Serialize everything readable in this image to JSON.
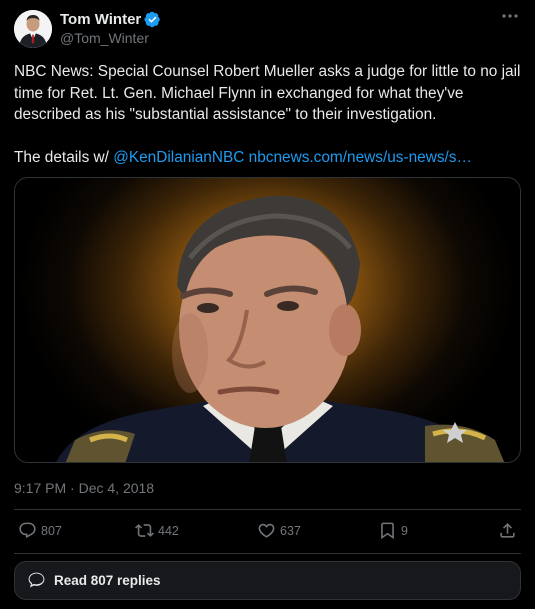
{
  "author": {
    "display_name": "Tom Winter",
    "handle": "@Tom_Winter",
    "verified": true,
    "verified_color": "#1d9bf0"
  },
  "more_icon": "ellipsis-icon",
  "tweet": {
    "text_main": "NBC News: Special Counsel Robert Mueller asks a judge for little to no jail time for Ret. Lt. Gen. Michael Flynn in exchanged for what they've described as his \"substantial assistance\" to their investigation.\n\nThe details w/ ",
    "mention": "@KenDilanianNBC",
    "link": "nbcnews.com/news/us-news/s…",
    "link_color": "#1d9bf0"
  },
  "media": {
    "icon": "photo-icon"
  },
  "timestamp": {
    "time": "9:17 PM",
    "separator": " · ",
    "date": "Dec 4, 2018"
  },
  "actions": {
    "reply": {
      "icon": "reply-icon",
      "count": "807"
    },
    "retweet": {
      "icon": "retweet-icon",
      "count": "442"
    },
    "like": {
      "icon": "heart-icon",
      "count": "637"
    },
    "bookmark": {
      "icon": "bookmark-icon",
      "count": "9"
    },
    "share": {
      "icon": "share-icon"
    }
  },
  "replies_button": {
    "icon": "speech-bubble-icon",
    "label": "Read 807 replies"
  },
  "colors": {
    "background": "#000000",
    "text": "#e7e9ea",
    "muted": "#71767b",
    "border": "#2f3336",
    "accent": "#1d9bf0"
  }
}
